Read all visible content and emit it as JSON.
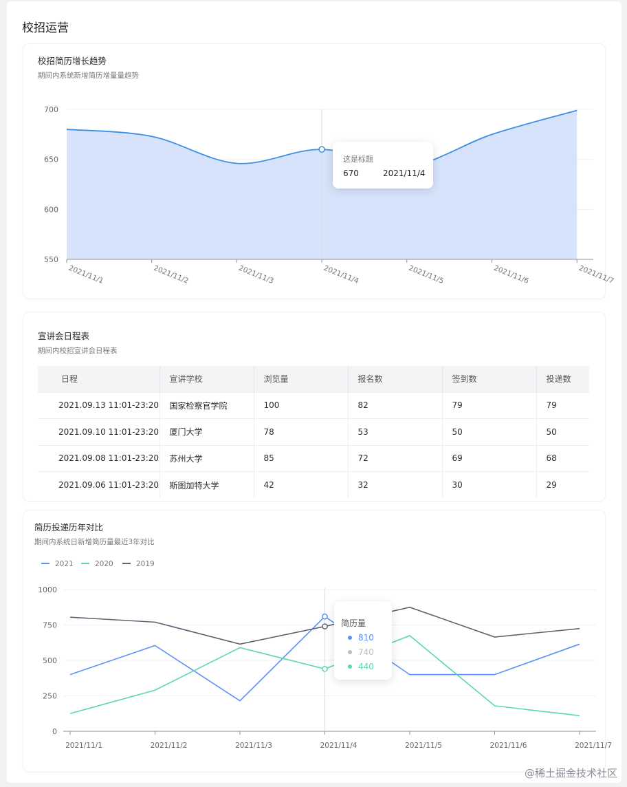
{
  "page_title": "校招运营",
  "cards": {
    "growth": {
      "title": "校招简历增长趋势",
      "subtitle": "期间内系统新增简历增量量趋势"
    },
    "schedule": {
      "title": "宣讲会日程表",
      "subtitle": "期间内校招宣讲会日程表"
    },
    "compare": {
      "title": "简历投递历年对比",
      "subtitle": "期间内系统日新增简历量最近3年对比"
    }
  },
  "growth_tooltip": {
    "title": "这是标题",
    "value": "670",
    "date": "2021/11/4"
  },
  "compare_tooltip": {
    "title": "简历量",
    "items": [
      {
        "value": "810",
        "color": "#5b8ff9"
      },
      {
        "value": "740",
        "color": "#b9bcc4"
      },
      {
        "value": "440",
        "color": "#5ad8a6"
      }
    ]
  },
  "table": {
    "headers": [
      "日程",
      "宣讲学校",
      "浏览量",
      "报名数",
      "签到数",
      "投递数"
    ],
    "rows": [
      [
        "2021.09.13 11:01-23:20",
        "国家检察官学院",
        "100",
        "82",
        "79",
        "79"
      ],
      [
        "2021.09.10 11:01-23:20",
        "厦门大学",
        "78",
        "53",
        "50",
        "50"
      ],
      [
        "2021.09.08 11:01-23:20",
        "苏州大学",
        "85",
        "72",
        "69",
        "68"
      ],
      [
        "2021.09.06 11:01-23:20",
        "斯图加特大学",
        "42",
        "32",
        "30",
        "29"
      ]
    ]
  },
  "watermark": "@稀土掘金技术社区",
  "chart_data": [
    {
      "type": "area",
      "title": "校招简历增长趋势",
      "x": [
        "2021/11/1",
        "2021/11/2",
        "2021/11/3",
        "2021/11/4",
        "2021/11/5",
        "2021/11/6",
        "2021/11/7"
      ],
      "values": [
        680,
        673,
        646,
        660,
        643,
        675,
        699
      ],
      "ylim": [
        550,
        700
      ],
      "yticks": [
        550,
        600,
        650,
        700
      ],
      "fill_color": "#d6e3fb",
      "line_color": "#3d8fe6",
      "grid": true,
      "highlight_index": 3
    },
    {
      "type": "line",
      "title": "简历投递历年对比",
      "x": [
        "2021/11/1",
        "2021/11/2",
        "2021/11/3",
        "2021/11/4",
        "2021/11/5",
        "2021/11/6",
        "2021/11/7"
      ],
      "series": [
        {
          "name": "2021",
          "color": "#5b8ff9",
          "values": [
            400,
            605,
            215,
            810,
            400,
            400,
            615
          ]
        },
        {
          "name": "2020",
          "color": "#5ad8a6",
          "values": [
            125,
            290,
            590,
            440,
            675,
            180,
            110
          ]
        },
        {
          "name": "2019",
          "color": "#5d6272",
          "values": [
            805,
            770,
            615,
            740,
            875,
            665,
            725
          ]
        }
      ],
      "ylim": [
        0,
        1000
      ],
      "yticks": [
        0,
        250,
        500,
        750,
        1000
      ],
      "legend": "top-left",
      "grid": true,
      "highlight_index": 3
    }
  ]
}
